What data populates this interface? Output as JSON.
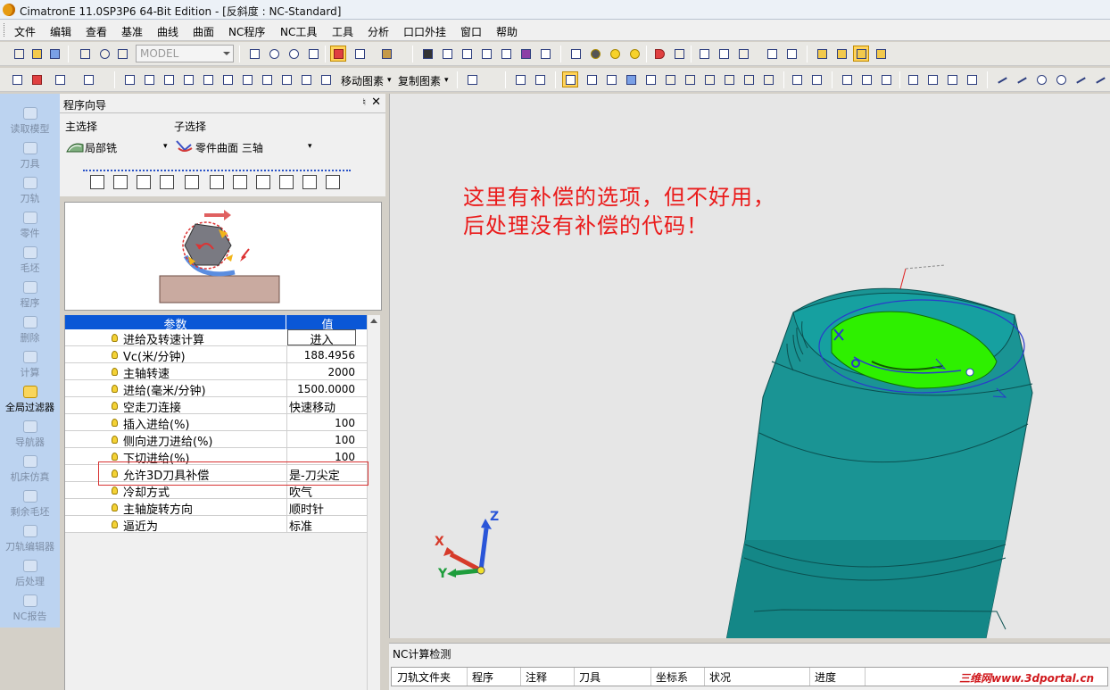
{
  "window": {
    "title": "CimatronE 11.0SP3P6 64-Bit Edition - [反斜度 : NC-Standard]"
  },
  "menu": [
    "文件",
    "编辑",
    "查看",
    "基准",
    "曲线",
    "曲面",
    "NC程序",
    "NC工具",
    "工具",
    "分析",
    "口口外挂",
    "窗口",
    "帮助"
  ],
  "toolbar": {
    "model_dropdown": "MODEL",
    "move_feature": "移动图素",
    "copy_feature": "复制图素"
  },
  "left_sidebar": [
    {
      "label": "读取模型",
      "icon": "read-model-icon"
    },
    {
      "label": "刀具",
      "icon": "tool-icon"
    },
    {
      "label": "刀轨",
      "icon": "toolpath-icon"
    },
    {
      "label": "零件",
      "icon": "part-icon"
    },
    {
      "label": "毛坯",
      "icon": "stock-icon"
    },
    {
      "label": "程序",
      "icon": "procedure-icon"
    },
    {
      "label": "删除",
      "icon": "delete-icon"
    },
    {
      "label": "计算",
      "icon": "compute-icon"
    },
    {
      "label": "全局过滤器",
      "icon": "global-filter-icon"
    },
    {
      "label": "导航器",
      "icon": "navigator-icon"
    },
    {
      "label": "机床仿真",
      "icon": "machine-sim-icon"
    },
    {
      "label": "剩余毛坯",
      "icon": "remaining-stock-icon"
    },
    {
      "label": "刀轨编辑器",
      "icon": "toolpath-editor-icon"
    },
    {
      "label": "后处理",
      "icon": "post-process-icon"
    },
    {
      "label": "NC报告",
      "icon": "nc-report-icon"
    }
  ],
  "wizard": {
    "title": "程序向导",
    "pin": "♮",
    "close": "✕",
    "main_select_label": "主选择",
    "main_select_value": "局部铣",
    "sub_select_label": "子选择",
    "sub_select_value": "零件曲面 三轴"
  },
  "param_table": {
    "header_param": "参数",
    "header_value": "值",
    "rows": [
      {
        "name": "进给及转速计算",
        "value": "进入"
      },
      {
        "name": "Vc(米/分钟)",
        "value": "188.4956"
      },
      {
        "name": "主轴转速",
        "value": "2000"
      },
      {
        "name": "进给(毫米/分钟)",
        "value": "1500.0000"
      },
      {
        "name": "空走刀连接",
        "value": "快速移动"
      },
      {
        "name": "插入进给(%)",
        "value": "100"
      },
      {
        "name": "侧向进刀进给(%)",
        "value": "100"
      },
      {
        "name": "下切进给(%)",
        "value": "100"
      },
      {
        "name": "允许3D刀具补偿",
        "value": "是-刀尖定"
      },
      {
        "name": "冷却方式",
        "value": "吹气"
      },
      {
        "name": "主轴旋转方向",
        "value": "顺时针"
      },
      {
        "name": "逼近为",
        "value": "标准"
      }
    ]
  },
  "annotation": {
    "line1": "这里有补偿的选项，但不好用，",
    "line2": "后处理没有补偿的代码！"
  },
  "axes": {
    "x": "X",
    "y": "Y",
    "z": "Z"
  },
  "nc_panel": {
    "title": "NC计算检测",
    "columns": [
      "刀轨文件夹",
      "程序",
      "注释",
      "刀具",
      "坐标系",
      "状况",
      "进度"
    ]
  },
  "watermark": "三维网www.3dportal.cn",
  "colors": {
    "part_teal": "#1a9494",
    "highlight_green": "#2ef000",
    "annotation_red": "#ea1b1b",
    "header_blue": "#0a57d6",
    "sidebar_blue": "#bcd3f0"
  }
}
